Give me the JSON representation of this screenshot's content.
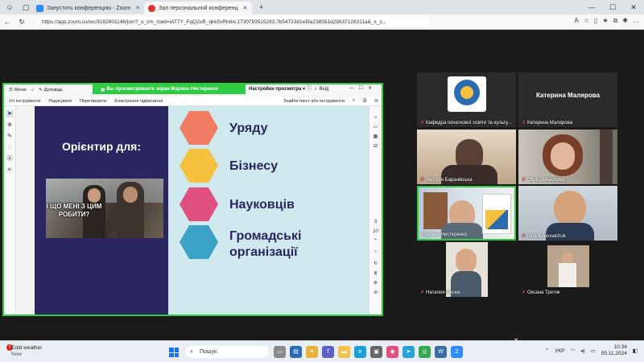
{
  "browser": {
    "tabs": [
      {
        "label": "Запустить конференцию - Zoom",
        "fav_color": "#2d8cff",
        "active": false
      },
      {
        "label": "Зал персональной конференц",
        "fav_color": "#e03131",
        "active": true
      }
    ],
    "new_tab": "+",
    "url": "https://app.zoom.us/wc/3182801146/join?_x_zm_rtaid=iAT7Y_FqQ2uB_qkk5vRh6w.1730793515283.7b54723d1e5fa238551d29837126311a&_x_z...",
    "win_min": "—",
    "win_max": "☐",
    "win_close": "✕"
  },
  "share": {
    "menu_label": "Меню",
    "doc_title": "Доповідь",
    "banner_text": "Вы просматриваете экран  Марина Нестеренко",
    "banner_settings": "Настройки просмотра",
    "exit_label": "Вхід",
    "tools": [
      "Усі інструменти",
      "Редагувати",
      "Перетворити",
      "Електронне підписання"
    ],
    "search_placeholder": "Знайти текст або інструменти",
    "page_num": "3",
    "page_total": "10"
  },
  "slide": {
    "title": "Орієнтир для:",
    "meme_caption": "І ЩО МЕНІ З ЦИМ РОБИТИ?",
    "items": [
      {
        "label": "Уряду",
        "color": "#f07c63"
      },
      {
        "label": "Бізнесу",
        "color": "#f6c13c"
      },
      {
        "label": "Науковців",
        "color": "#e04f7e"
      },
      {
        "label": "Громадські організації",
        "color": "#3aa3c7"
      }
    ]
  },
  "gallery": {
    "participants": [
      {
        "name": "Кафедра початкової освіти та культу...",
        "type": "logo"
      },
      {
        "name": "Катерина Малярова",
        "type": "text"
      },
      {
        "name": "Вікторія Баранівська",
        "type": "video"
      },
      {
        "name": "Olga Derkachova",
        "type": "video"
      },
      {
        "name": "Марина Нестеренко",
        "type": "video"
      },
      {
        "name": "Inna Konovalchuk",
        "type": "video"
      },
      {
        "name": "Наталия Басюк",
        "type": "video"
      },
      {
        "name": "Оксана Третяк",
        "type": "video"
      }
    ]
  },
  "taskbar": {
    "weather_title": "Cold weather",
    "weather_sub": "Now",
    "badge": "1",
    "search_label": "Пошук",
    "language": "УКР",
    "time": "10:34",
    "date": "05.11.2024"
  }
}
